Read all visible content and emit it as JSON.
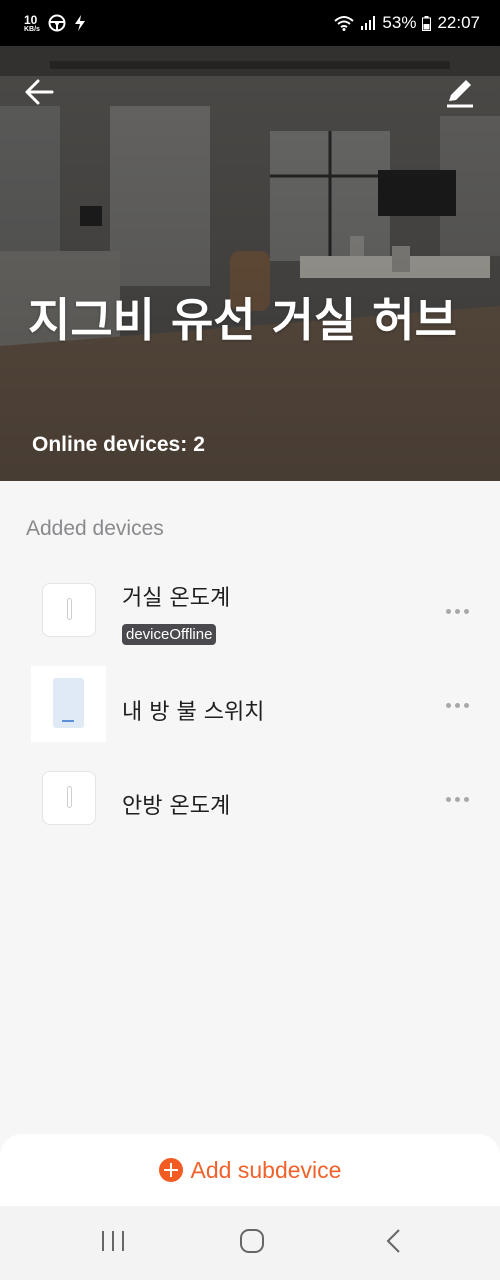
{
  "status_bar": {
    "net_speed_value": "10",
    "net_speed_unit": "KB/s",
    "battery": "53%",
    "time": "22:07"
  },
  "header": {
    "title": "지그비 유선 거실 허브",
    "online_label": "Online devices:",
    "online_count": "2"
  },
  "section": {
    "label": "Added devices"
  },
  "devices": [
    {
      "name": "거실 온도계",
      "status": "deviceOffline",
      "icon": "thermometer-sensor-icon"
    },
    {
      "name": "내 방 불 스위치",
      "status": "",
      "icon": "wall-switch-icon"
    },
    {
      "name": "안방 온도계",
      "status": "",
      "icon": "thermometer-sensor-icon"
    }
  ],
  "add_button": {
    "label": "Add subdevice"
  },
  "colors": {
    "accent": "#f25b22",
    "badge": "#4a4a4e",
    "background": "#f6f6f6"
  }
}
